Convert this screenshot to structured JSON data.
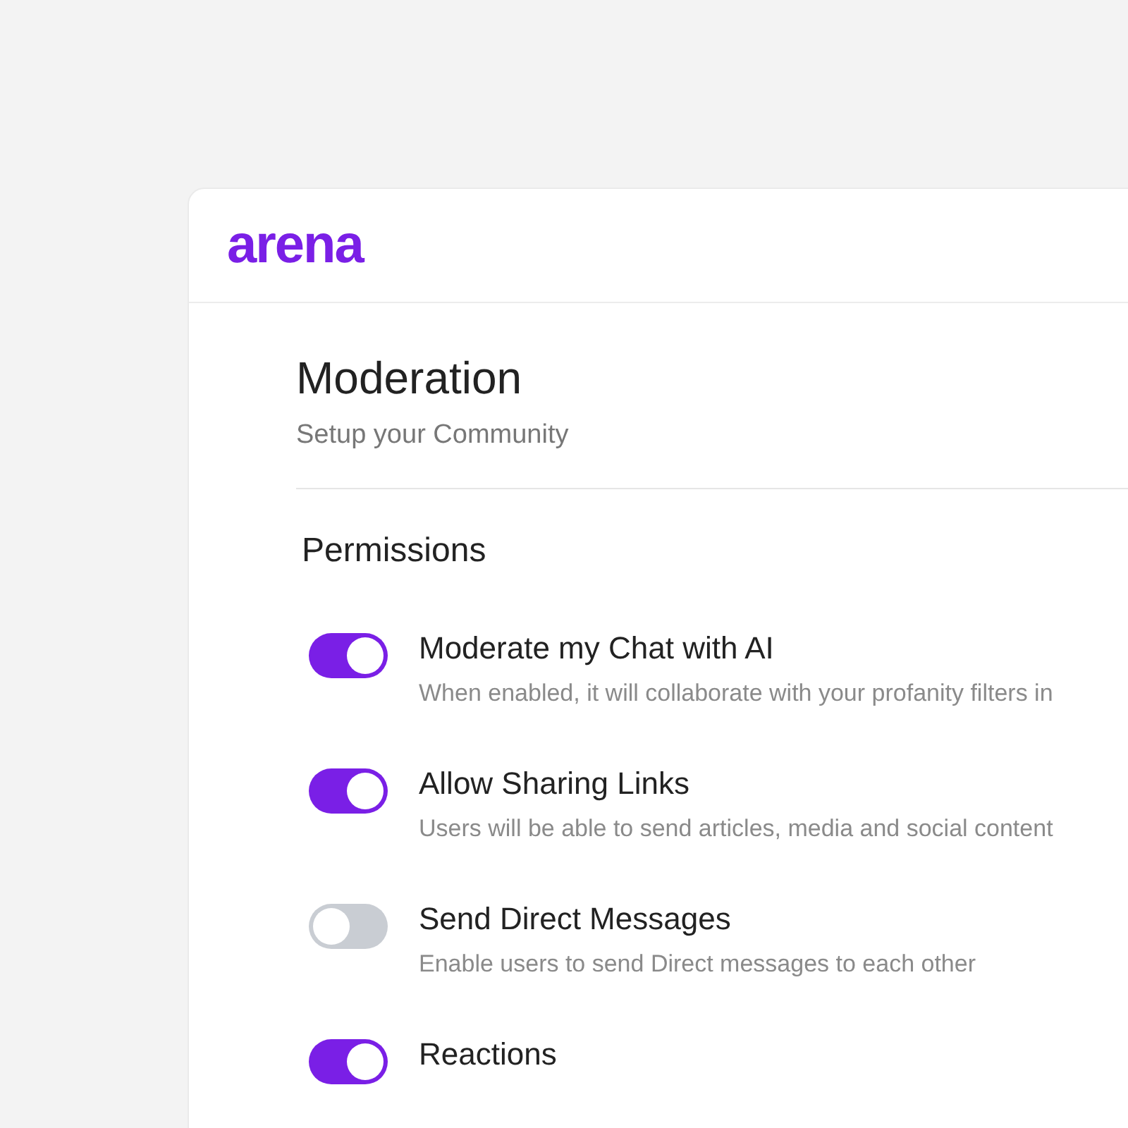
{
  "logo": "arena",
  "page": {
    "title": "Moderation",
    "subtitle": "Setup your Community"
  },
  "section": {
    "title": "Permissions"
  },
  "permissions": [
    {
      "title": "Moderate my Chat with AI",
      "description": "When enabled, it will collaborate with your profanity filters in",
      "on": true
    },
    {
      "title": "Allow Sharing Links",
      "description": "Users will be able to send articles, media and social content",
      "on": true
    },
    {
      "title": "Send Direct Messages",
      "description": "Enable users to send Direct messages to each other",
      "on": false
    },
    {
      "title": "Reactions",
      "on": true
    }
  ]
}
